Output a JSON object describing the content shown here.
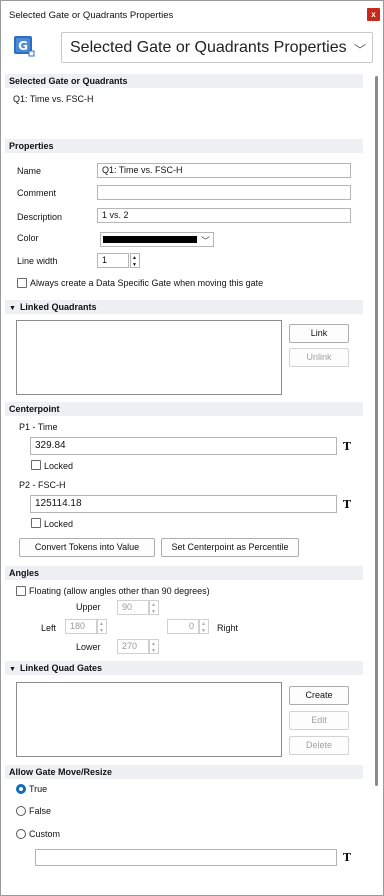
{
  "window": {
    "title": "Selected Gate or Quadrants Properties",
    "close_label": "x"
  },
  "header": {
    "icon_letter": "G",
    "select_value": "Selected Gate or Quadrants Properties"
  },
  "selected": {
    "section": "Selected Gate or Quadrants",
    "value": "Q1: Time vs. FSC-H"
  },
  "properties": {
    "section": "Properties",
    "name_label": "Name",
    "name_value": "Q1: Time vs. FSC-H",
    "comment_label": "Comment",
    "comment_value": "",
    "description_label": "Description",
    "description_value": "1 vs. 2",
    "color_label": "Color",
    "color_value": "#000000",
    "linewidth_label": "Line width",
    "linewidth_value": "1",
    "always_create_label": "Always create a Data Specific Gate when moving this gate"
  },
  "linked_quadrants": {
    "section": "Linked Quadrants",
    "link_label": "Link",
    "unlink_label": "Unlink"
  },
  "centerpoint": {
    "section": "Centerpoint",
    "p1_label": "P1 - Time",
    "p1_value": "329.84",
    "p1_locked": "Locked",
    "p2_label": "P2 - FSC-H",
    "p2_value": "125114.18",
    "p2_locked": "Locked",
    "token_symbol": "T",
    "convert_label": "Convert Tokens into Value",
    "percentile_label": "Set Centerpoint as Percentile"
  },
  "angles": {
    "section": "Angles",
    "floating_label": "Floating (allow angles other than 90 degrees)",
    "upper_label": "Upper",
    "upper_value": "90",
    "left_label": "Left",
    "left_value": "180",
    "right_label": "Right",
    "right_value": "0",
    "lower_label": "Lower",
    "lower_value": "270"
  },
  "linked_quad_gates": {
    "section": "Linked Quad Gates",
    "create_label": "Create",
    "edit_label": "Edit",
    "delete_label": "Delete"
  },
  "allow_move": {
    "section": "Allow Gate Move/Resize",
    "true_label": "True",
    "false_label": "False",
    "custom_label": "Custom",
    "custom_value": "",
    "token_symbol": "T"
  },
  "colors": {
    "accent": "#0f6cbd",
    "close": "#c42b1c",
    "section_bg": "#eef0f4"
  },
  "icons": [
    "gate-icon",
    "chevron-down-icon",
    "close-icon",
    "triangle-down-icon",
    "token-icon"
  ]
}
